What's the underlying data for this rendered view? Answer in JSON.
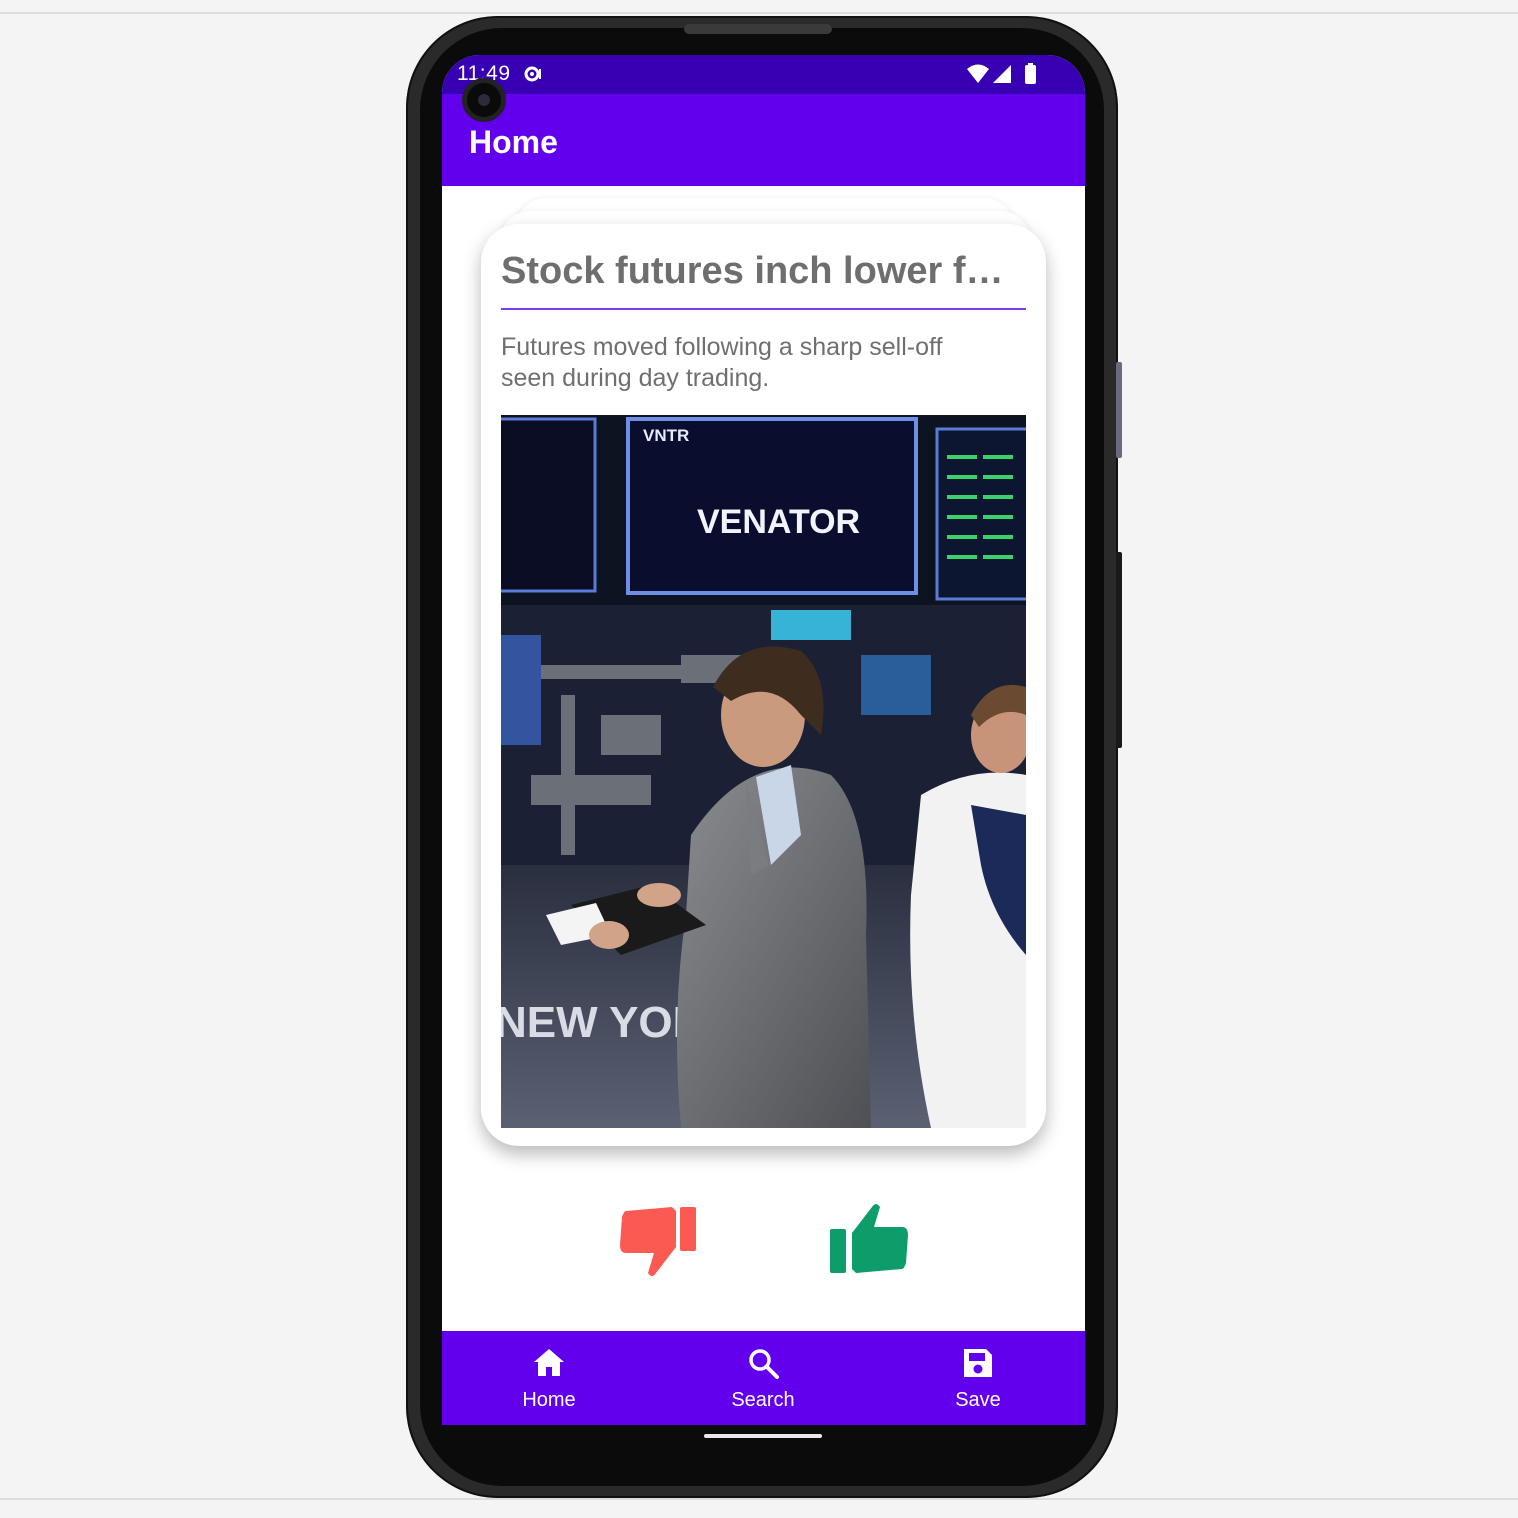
{
  "status_bar": {
    "time": "11:49",
    "icons": [
      "notification-dot-icon",
      "wifi-icon",
      "cellular-icon",
      "battery-icon"
    ]
  },
  "app_bar": {
    "title": "Home"
  },
  "card": {
    "title": "Stock futures inch lower foll...",
    "description": "Futures moved following a sharp sell-off seen during day trading.",
    "image": {
      "screen_text": "VENATOR",
      "ticker": "VNTR",
      "banner_text": "NEW YOR   K EX"
    }
  },
  "actions": {
    "dislike_icon": "thumbs-down-icon",
    "like_icon": "thumbs-up-icon",
    "dislike_color": "#fa5a52",
    "like_color": "#0c9d6a"
  },
  "bottom_nav": {
    "items": [
      {
        "label": "Home",
        "icon": "home-icon"
      },
      {
        "label": "Search",
        "icon": "search-icon"
      },
      {
        "label": "Save",
        "icon": "save-icon"
      }
    ]
  },
  "colors": {
    "primary": "#6200ee",
    "primary_dark": "#3700b3",
    "divider": "#7b3bf0"
  }
}
